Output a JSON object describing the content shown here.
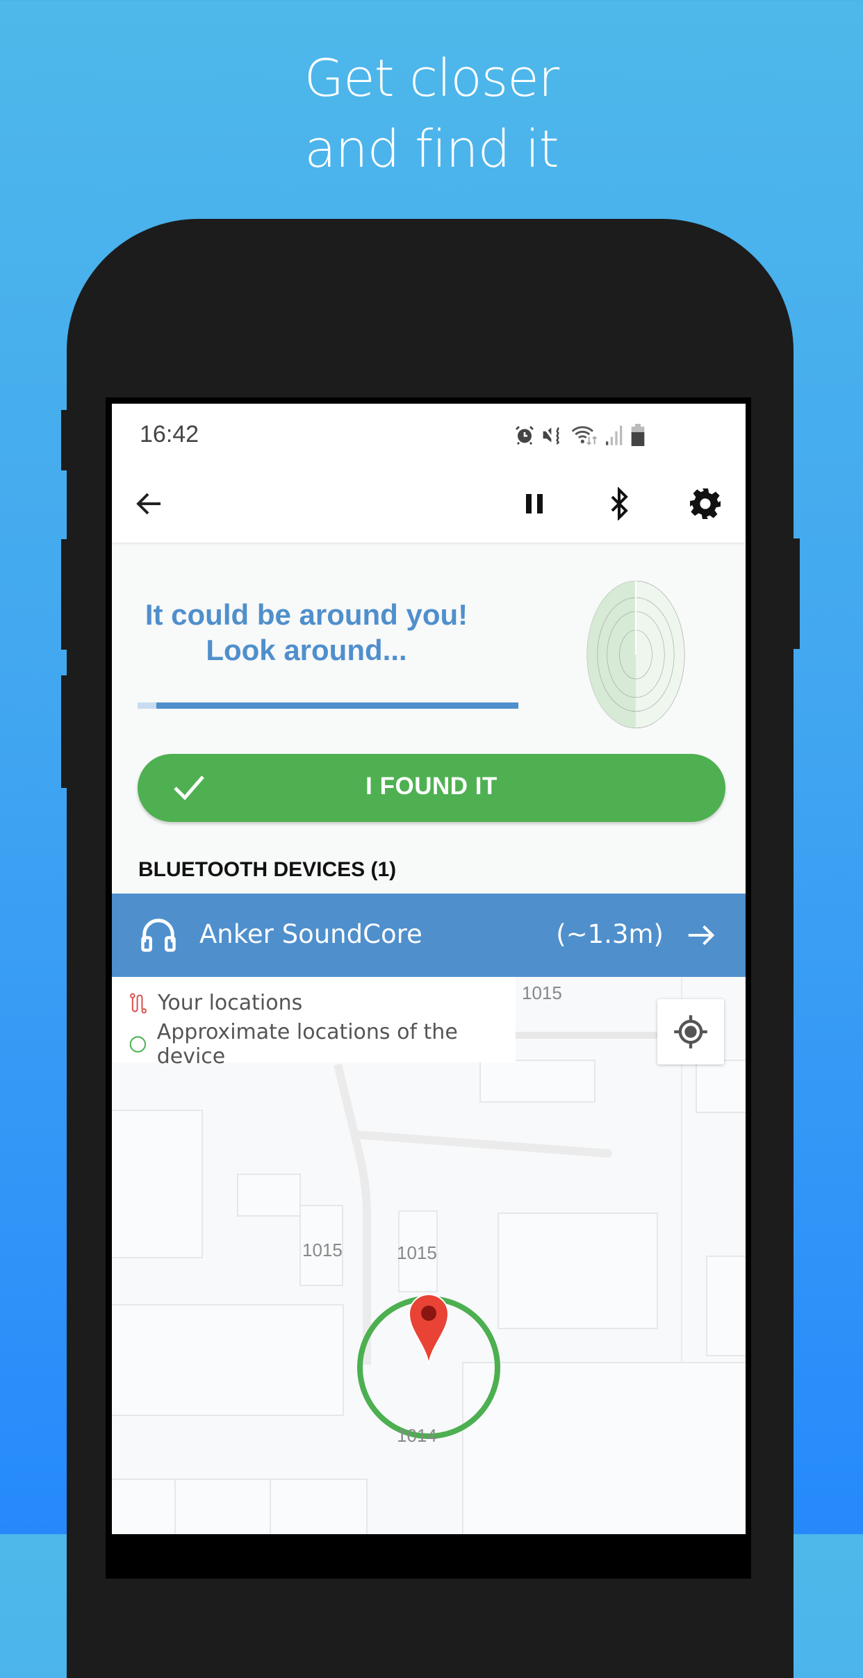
{
  "promo": {
    "headline_line1": "Get closer",
    "headline_line2": "and find it",
    "background_top": "#4eb8ea",
    "background_bottom": "#2589fc"
  },
  "statusbar": {
    "time": "16:42",
    "icons": [
      "alarm-icon",
      "vibrate-mute-icon",
      "wifi-icon",
      "signal-icon",
      "battery-icon"
    ]
  },
  "toolbar": {
    "back_icon": "arrow-left-icon",
    "actions": [
      "pause-icon",
      "bluetooth-icon",
      "gear-icon"
    ]
  },
  "search": {
    "title_line1": "It could be around you!",
    "title_line2": "Look around...",
    "progress_percent": 95,
    "accent": "#4f8fcc"
  },
  "found_button": {
    "label": "I FOUND IT",
    "icon": "check-icon",
    "color": "#4fb052"
  },
  "devices": {
    "heading": "BLUETOOTH DEVICES (1)",
    "items": [
      {
        "icon": "headphones-icon",
        "name": "Anker SoundCore",
        "distance": "(~1.3m)",
        "action_icon": "arrow-right-icon"
      }
    ]
  },
  "map": {
    "legend": [
      {
        "icon": "route-icon",
        "label": "Your locations",
        "color": "#d9534f"
      },
      {
        "icon": "circle-outline-icon",
        "label": "Approximate locations of the device",
        "color": "#4caf50"
      }
    ],
    "labels": [
      "1015",
      "1015",
      "1015",
      "1014"
    ],
    "locate_icon": "my-location-icon",
    "marker_color": "#e84335",
    "range_color": "#4caf50"
  }
}
